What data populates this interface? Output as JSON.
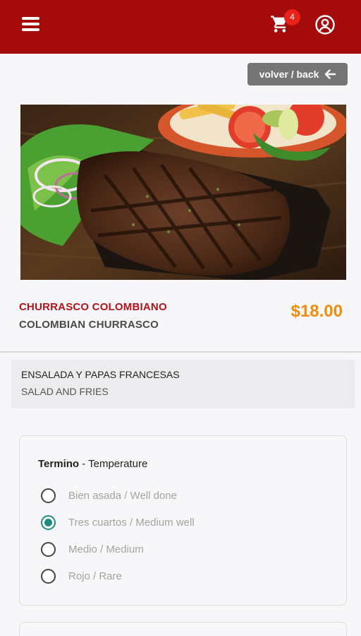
{
  "header": {
    "cart_count": "4",
    "menu_icon": "hamburger-menu-icon",
    "cart_icon": "cart-icon",
    "account_icon": "user-account-icon",
    "bar_color": "#a50b0b"
  },
  "back_button": {
    "label": "volver / back",
    "icon": "arrow-left-icon"
  },
  "product": {
    "image": "steak-plate-photo",
    "name_es": "CHURRASCO COLOMBIANO",
    "name_en": "COLOMBIAN CHURRASCO",
    "price": "$18.00",
    "description_es": "ENSALADA Y PAPAS FRANCESAS",
    "description_en": "SALAD AND FRIES"
  },
  "options": {
    "title_es": "Termino",
    "title_sep": " - ",
    "title_en": "Temperature",
    "items": [
      {
        "label": "Bien asada / Well done",
        "checked": false
      },
      {
        "label": "Tres cuartos / Medium well",
        "checked": true
      },
      {
        "label": "Medio / Medium",
        "checked": false
      },
      {
        "label": "Rojo / Rare",
        "checked": false
      }
    ]
  },
  "colors": {
    "accent_red": "#b3121c",
    "price_orange": "#ee8c0c",
    "radio_teal": "#1e8c85"
  }
}
